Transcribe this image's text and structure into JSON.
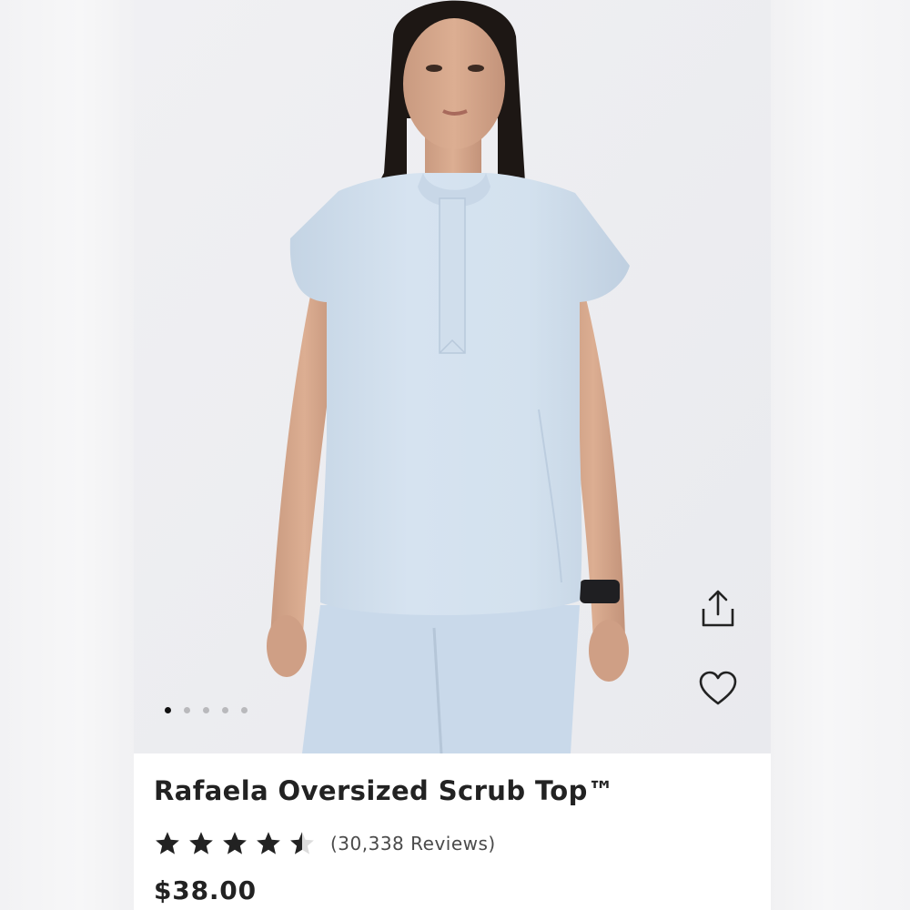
{
  "product": {
    "title": "Rafaela Oversized Scrub Top™",
    "rating": 4.5,
    "rating_max": 5,
    "reviews_label": "(30,338 Reviews)",
    "price": "$38.00",
    "color": "#d3e1ef"
  },
  "gallery": {
    "image_count": 5,
    "active_index": 0,
    "image_description": "Model wearing light blue scrub top"
  },
  "actions": {
    "share_icon": "share-icon",
    "favorite_icon": "heart-icon"
  }
}
